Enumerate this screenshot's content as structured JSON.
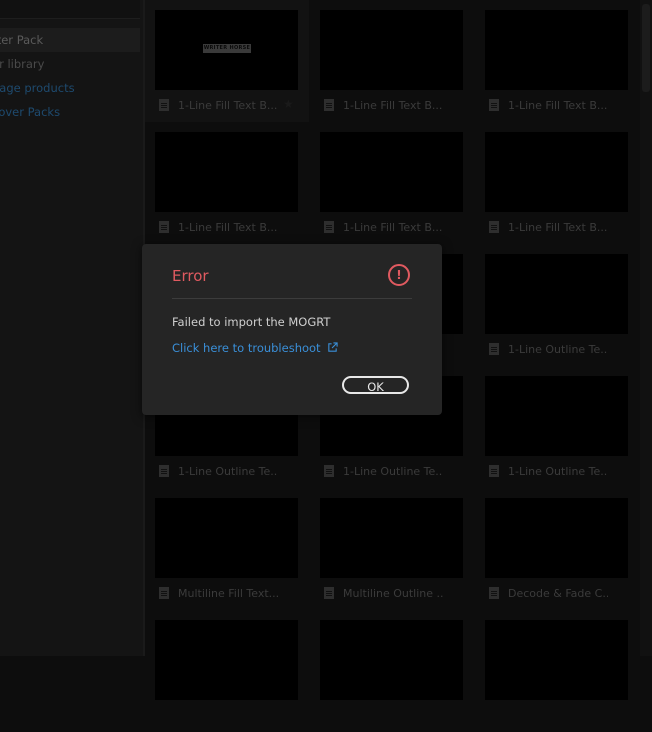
{
  "sidebar": {
    "items": [
      {
        "label": "rter Pack"
      },
      {
        "label": "er library"
      },
      {
        "label": "nage products"
      },
      {
        "label": "cover Packs"
      }
    ]
  },
  "grid": {
    "watermark": "WRITER HORSE",
    "cards": [
      {
        "label": "1-Line Fill Text B..."
      },
      {
        "label": "1-Line Fill Text B..."
      },
      {
        "label": "1-Line Fill Text B..."
      },
      {
        "label": "1-Line Fill Text B..."
      },
      {
        "label": "1-Line Fill Text B..."
      },
      {
        "label": "1-Line Fill Text B..."
      },
      {
        "label": ""
      },
      {
        "label": ""
      },
      {
        "label": "1-Line Outline Te..."
      },
      {
        "label": "1-Line Outline Te..."
      },
      {
        "label": "1-Line Outline Te..."
      },
      {
        "label": "1-Line Outline Te..."
      },
      {
        "label": "Multiline Fill Text..."
      },
      {
        "label": "Multiline Outline ..."
      },
      {
        "label": "Decode & Fade C..."
      }
    ]
  },
  "dialog": {
    "title": "Error",
    "message": "Failed to import the MOGRT",
    "link": "Click here to troubleshoot",
    "ok_label": "OK"
  },
  "colors": {
    "error": "#e05a60",
    "link": "#3a8fd8",
    "dialog_bg": "#252525"
  }
}
